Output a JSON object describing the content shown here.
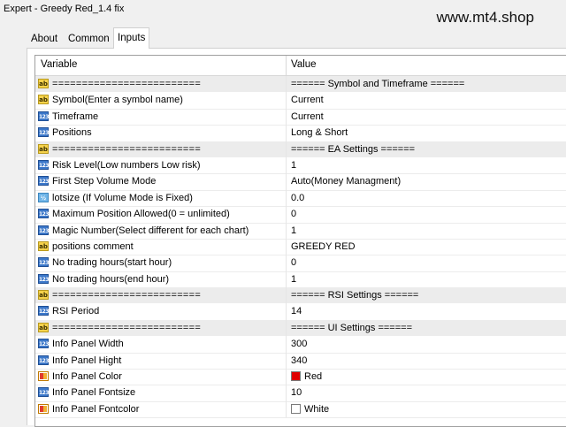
{
  "window": {
    "title": "Expert - Greedy Red_1.4 fix"
  },
  "watermark": "www.mt4.shop",
  "tabs": [
    {
      "label": "About",
      "active": false
    },
    {
      "label": "Common",
      "active": false
    },
    {
      "label": "Inputs",
      "active": true
    }
  ],
  "table": {
    "headers": {
      "variable": "Variable",
      "value": "Value"
    },
    "rows": [
      {
        "icon": "ab",
        "name": "=========================",
        "value": "======  Symbol and Timeframe  ======",
        "separator": true
      },
      {
        "icon": "ab",
        "name": "Symbol(Enter a symbol name)",
        "value": "Current"
      },
      {
        "icon": "num",
        "name": "Timeframe",
        "value": "Current"
      },
      {
        "icon": "num",
        "name": "Positions",
        "value": "Long & Short"
      },
      {
        "icon": "ab",
        "name": "=========================",
        "value": "======  EA Settings  ======",
        "separator": true
      },
      {
        "icon": "num",
        "name": "Risk Level(Low numbers Low risk)",
        "value": "1"
      },
      {
        "icon": "num",
        "name": "First Step Volume Mode",
        "value": "Auto(Money Managment)"
      },
      {
        "icon": "dec",
        "name": "lotsize (If Volume Mode is Fixed)",
        "value": "0.0"
      },
      {
        "icon": "num",
        "name": "Maximum Position Allowed(0 = unlimited)",
        "value": "0"
      },
      {
        "icon": "num",
        "name": "Magic Number(Select different for each chart)",
        "value": "1"
      },
      {
        "icon": "ab",
        "name": "positions  comment",
        "value": "GREEDY RED"
      },
      {
        "icon": "num",
        "name": "No trading hours(start hour)",
        "value": "0"
      },
      {
        "icon": "num",
        "name": "No trading hours(end hour)",
        "value": "1"
      },
      {
        "icon": "ab",
        "name": "=========================",
        "value": "======  RSI Settings  ======",
        "separator": true
      },
      {
        "icon": "num",
        "name": "RSI Period",
        "value": "14"
      },
      {
        "icon": "ab",
        "name": "=========================",
        "value": "======  UI Settings  ======",
        "separator": true
      },
      {
        "icon": "num",
        "name": "Info Panel Width",
        "value": "300"
      },
      {
        "icon": "num",
        "name": "Info Panel Hight",
        "value": "340"
      },
      {
        "icon": "clr",
        "name": "Info Panel Color",
        "value": "Red",
        "swatch": "#e00000"
      },
      {
        "icon": "num",
        "name": "Info Panel Fontsize",
        "value": "10"
      },
      {
        "icon": "clr",
        "name": "Info Panel Fontcolor",
        "value": "White",
        "swatch": "#ffffff"
      }
    ]
  }
}
